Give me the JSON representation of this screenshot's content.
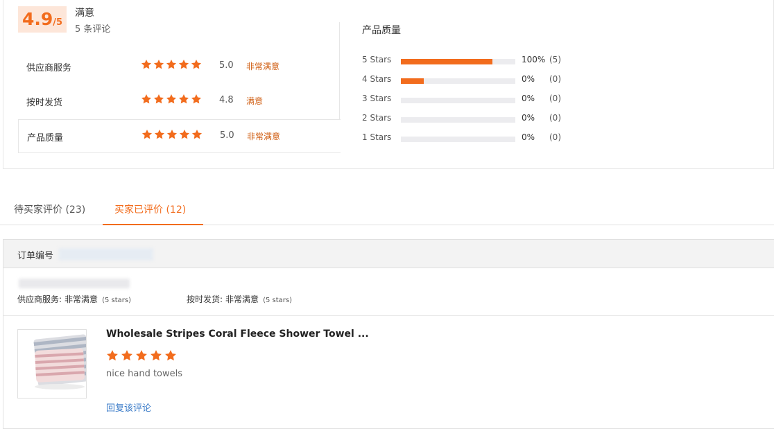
{
  "summary": {
    "score": "4.9",
    "score_max": "/5",
    "score_word": "满意",
    "review_count": "5 条评论",
    "ratings": [
      {
        "label": "供应商服务",
        "stars": 5,
        "value": "5.0",
        "word": "非常满意"
      },
      {
        "label": "按时发货",
        "stars": 5,
        "value": "4.8",
        "word": "满意"
      },
      {
        "label": "产品质量",
        "stars": 5,
        "value": "5.0",
        "word": "非常满意"
      }
    ]
  },
  "quality": {
    "title": "产品质量",
    "rows": [
      {
        "label": "5 Stars",
        "fill": 0.8,
        "pct": "100%",
        "count": "(5)"
      },
      {
        "label": "4 Stars",
        "fill": 0.2,
        "pct": "0%",
        "count": "(0)"
      },
      {
        "label": "3 Stars",
        "fill": 0,
        "pct": "0%",
        "count": "(0)"
      },
      {
        "label": "2 Stars",
        "fill": 0,
        "pct": "0%",
        "count": "(0)"
      },
      {
        "label": "1 Stars",
        "fill": 0,
        "pct": "0%",
        "count": "(0)"
      }
    ]
  },
  "tabs": [
    {
      "label": "待买家评价 (23)",
      "active": false
    },
    {
      "label": "买家已评价 (12)",
      "active": true
    }
  ],
  "order": {
    "number_label": "订单编号",
    "supplier_service_label": "供应商服务:",
    "supplier_service_value": "非常满意",
    "supplier_service_stars": "(5 stars)",
    "ontime_label": "按时发货:",
    "ontime_value": "非常满意",
    "ontime_stars": "(5 stars)",
    "product_title": "Wholesale Stripes Coral Fleece Shower Towel ...",
    "review_stars": 5,
    "review_text": "nice hand towels",
    "reply_link": "回复该评论"
  },
  "colors": {
    "accent": "#f26c1d",
    "score_bg": "#fde6d9",
    "link": "#3a7bc8"
  }
}
